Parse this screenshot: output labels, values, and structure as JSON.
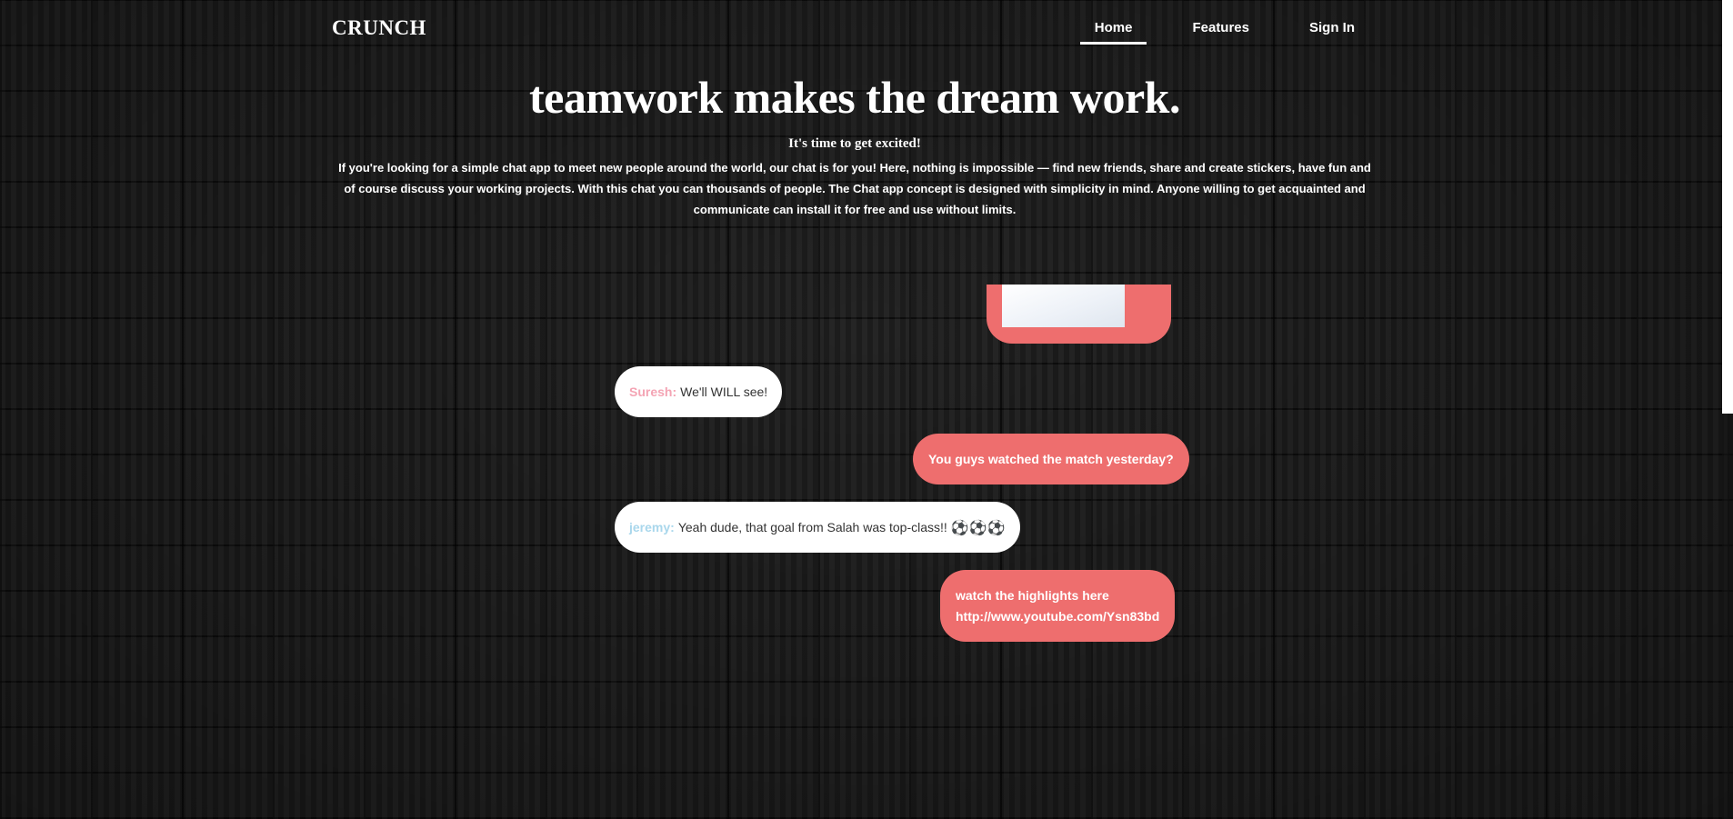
{
  "header": {
    "brand": "CRUNCH",
    "nav": [
      {
        "label": "Home",
        "active": true
      },
      {
        "label": "Features",
        "active": false
      },
      {
        "label": "Sign In",
        "active": false
      }
    ]
  },
  "hero": {
    "title": "teamwork makes the dream work.",
    "subtitle": "It's time to get excited!",
    "body": "If you're looking for a simple chat app to meet new people around the world, our chat is for you! Here, nothing is impossible — find new friends, share and create stickers, have fun and of course discuss your working projects. With this chat you can thousands of people. The Chat app concept is designed with simplicity in mind. Anyone willing to get acquainted and communicate can install it for free and use without limits."
  },
  "chat": {
    "messages": [
      {
        "type": "sent-image"
      },
      {
        "type": "received",
        "sender": "Suresh:",
        "text": "We'll WILL see!"
      },
      {
        "type": "sent",
        "text": "You guys watched the match yesterday?"
      },
      {
        "type": "received",
        "sender": "jeremy:",
        "text": "Yeah dude, that goal from Salah was top-class!!",
        "emoji": "⚽⚽⚽"
      },
      {
        "type": "sent",
        "line1": "watch the highlights here",
        "line2": "http://www.youtube.com/Ysn83bd"
      }
    ]
  },
  "colors": {
    "accent": "#ee6e6e",
    "background": "#1d1d1d",
    "sender_pink": "#f4a4b4",
    "sender_blue": "#a9d7ec"
  }
}
